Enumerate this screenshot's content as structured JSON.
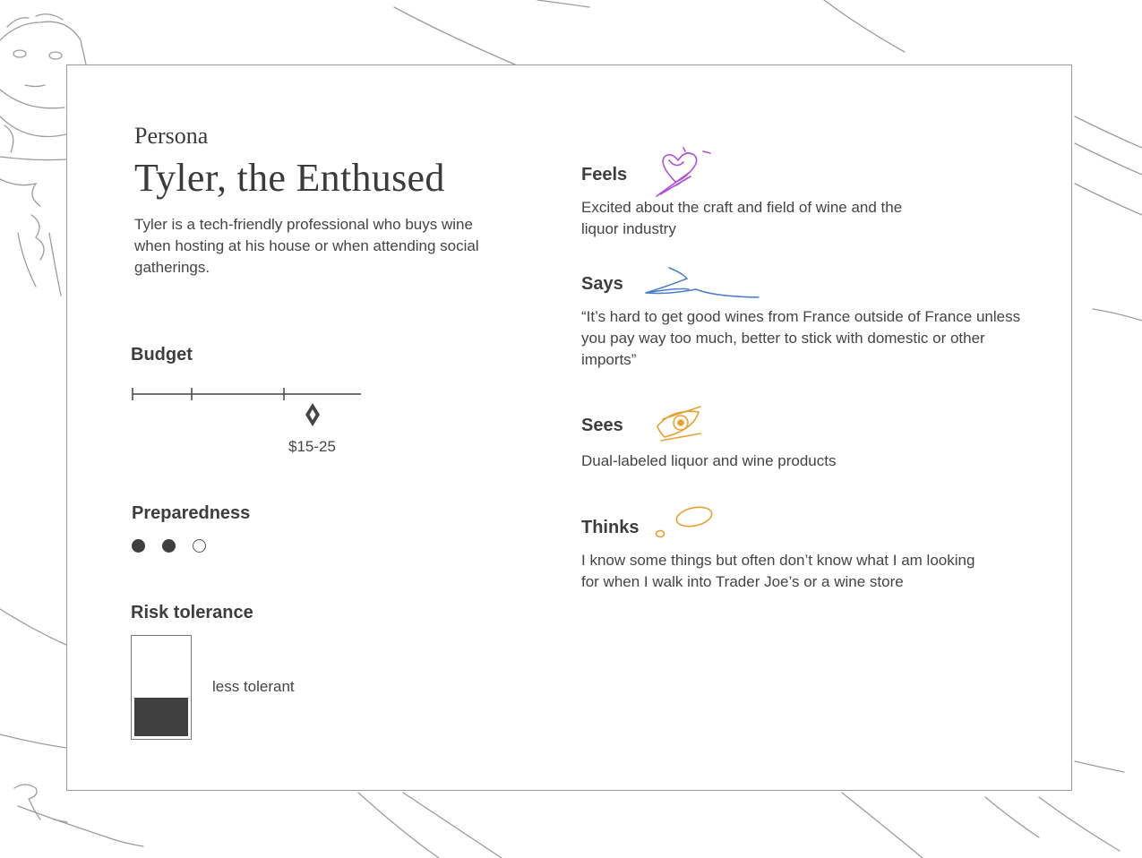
{
  "header": {
    "kicker": "Persona",
    "title": "Tyler, the Enthused",
    "intro": "Tyler is a tech-friendly professional who buys wine when hosting at his house or when attending social gatherings."
  },
  "budget": {
    "label": "Budget",
    "value_label": "$15-25"
  },
  "preparedness": {
    "label": "Preparedness",
    "level": 2,
    "max": 3
  },
  "risk": {
    "label": "Risk tolerance",
    "value_label": "less tolerant",
    "level": 0.4
  },
  "feels": {
    "label": "Feels",
    "text": "Excited about the craft and field of wine and the liquor industry",
    "icon": "heart-doodle-icon",
    "color": "#b04fd6"
  },
  "says": {
    "label": "Says",
    "text": "“It’s hard to get good wines from France outside of France unless you pay way too much, better to stick with domestic or other imports”",
    "icon": "speech-squiggle-icon",
    "color": "#4a7fc8"
  },
  "sees": {
    "label": "Sees",
    "text": "Dual-labeled liquor and wine products",
    "icon": "eye-doodle-icon",
    "color": "#e8a030"
  },
  "thinks": {
    "label": "Thinks",
    "text": "I know some things but often don’t know what I am looking for when I walk into Trader Joe’s or a wine store",
    "icon": "thought-bubble-icon",
    "color": "#e8a030"
  }
}
